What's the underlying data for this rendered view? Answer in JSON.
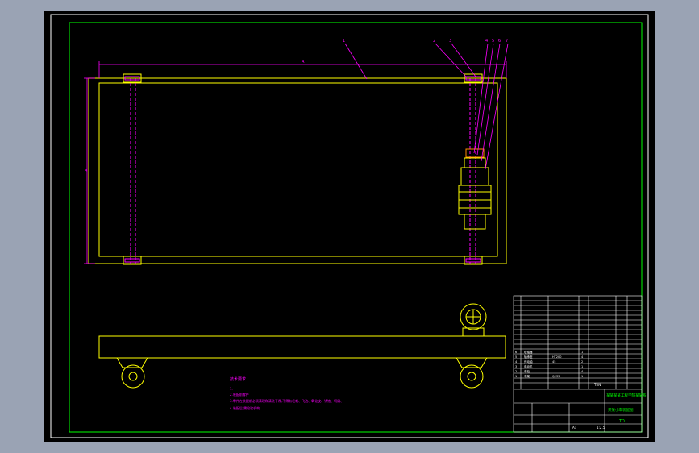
{
  "notes": {
    "heading": "技术要求",
    "lines": [
      "1.",
      "2.装配前零件",
      "3.零件在装配前必须清理和清洗干净,不得有毛刺、飞边、氧化皮、锈蚀、切屑、",
      "4.装配后,需检验机构"
    ]
  },
  "title_block": {
    "designation": "TD",
    "company": "某某某某工程学院某某系",
    "drawing_name": "某某小车装配图",
    "weight": "TRN",
    "scale": "1:2.5",
    "sheet": "A1"
  },
  "part_numbers": [
    "1",
    "2",
    "3",
    "4",
    "5",
    "6",
    "7"
  ],
  "bom_rows": [
    {
      "no": "6",
      "name": "联轴器",
      "material": "",
      "qty": "1"
    },
    {
      "no": "5",
      "name": "轴承座",
      "material": "HT200",
      "qty": "4"
    },
    {
      "no": "4",
      "name": "传动轴",
      "material": "45",
      "qty": "2"
    },
    {
      "no": "3",
      "name": "电动机",
      "material": "",
      "qty": "1"
    },
    {
      "no": "2",
      "name": "车轮",
      "material": "",
      "qty": "4"
    },
    {
      "no": "1",
      "name": "车架",
      "material": "Q235",
      "qty": "1"
    }
  ],
  "dim_labels": [
    "A",
    "B"
  ],
  "colors": {
    "background": "#000000",
    "frame_outer": "#ffffff",
    "frame_inner": "#00ff00",
    "drawing": "#ffff00",
    "annotation": "#ff00ff",
    "table": "#ffffff"
  }
}
